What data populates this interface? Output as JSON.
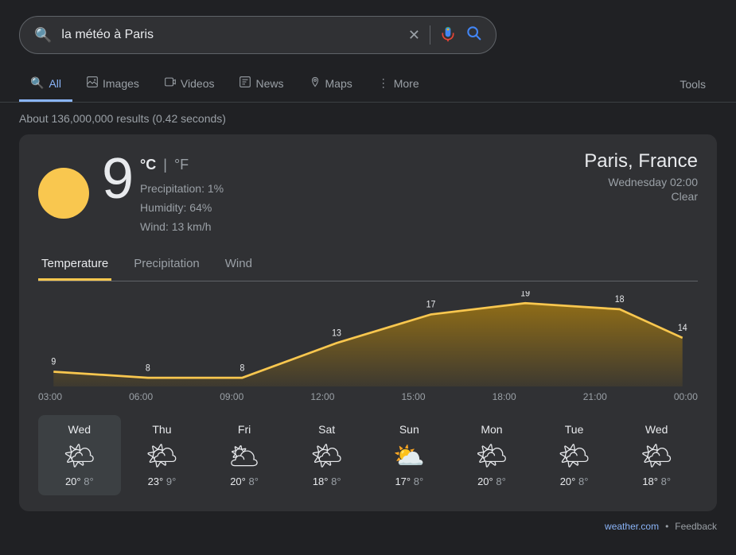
{
  "search": {
    "query": "la météo à Paris",
    "placeholder": "la météo à Paris",
    "results_count": "About 136,000,000 results (0.42 seconds)"
  },
  "tabs": {
    "items": [
      {
        "label": "All",
        "icon": "🔍",
        "active": true
      },
      {
        "label": "Images",
        "icon": "🖼",
        "active": false
      },
      {
        "label": "Videos",
        "icon": "▶",
        "active": false
      },
      {
        "label": "News",
        "icon": "📰",
        "active": false
      },
      {
        "label": "Maps",
        "icon": "📍",
        "active": false
      },
      {
        "label": "More",
        "icon": "⋮",
        "active": false
      }
    ],
    "tools_label": "Tools"
  },
  "weather": {
    "temperature": "9",
    "unit_celsius": "°C",
    "unit_sep": "|",
    "unit_fahrenheit": "°F",
    "precipitation": "Precipitation: 1%",
    "humidity": "Humidity: 64%",
    "wind": "Wind: 13 km/h",
    "location": "Paris, France",
    "datetime": "Wednesday 02:00",
    "condition": "Clear",
    "sub_tabs": [
      "Temperature",
      "Precipitation",
      "Wind"
    ],
    "chart": {
      "times": [
        "03:00",
        "06:00",
        "09:00",
        "12:00",
        "15:00",
        "18:00",
        "21:00",
        "00:00"
      ],
      "values": [
        9,
        8,
        8,
        13,
        17,
        19,
        18,
        14
      ],
      "labels_y_positions": [
        9,
        8,
        8,
        13,
        17,
        19,
        18,
        14
      ]
    },
    "days": [
      {
        "name": "Wed",
        "today": true,
        "high": "20°",
        "low": "8°",
        "icon": "🌤"
      },
      {
        "name": "Thu",
        "today": false,
        "high": "23°",
        "low": "9°",
        "icon": "🌤"
      },
      {
        "name": "Fri",
        "today": false,
        "high": "20°",
        "low": "8°",
        "icon": "🌥"
      },
      {
        "name": "Sat",
        "today": false,
        "high": "18°",
        "low": "8°",
        "icon": "🌤"
      },
      {
        "name": "Sun",
        "today": false,
        "high": "17°",
        "low": "8°",
        "icon": "⛅"
      },
      {
        "name": "Mon",
        "today": false,
        "high": "20°",
        "low": "8°",
        "icon": "🌤"
      },
      {
        "name": "Tue",
        "today": false,
        "high": "20°",
        "low": "8°",
        "icon": "🌤"
      },
      {
        "name": "Wed",
        "today": false,
        "high": "18°",
        "low": "8°",
        "icon": "🌤"
      }
    ],
    "source": "weather.com",
    "source_url": "#",
    "feedback_label": "Feedback"
  }
}
